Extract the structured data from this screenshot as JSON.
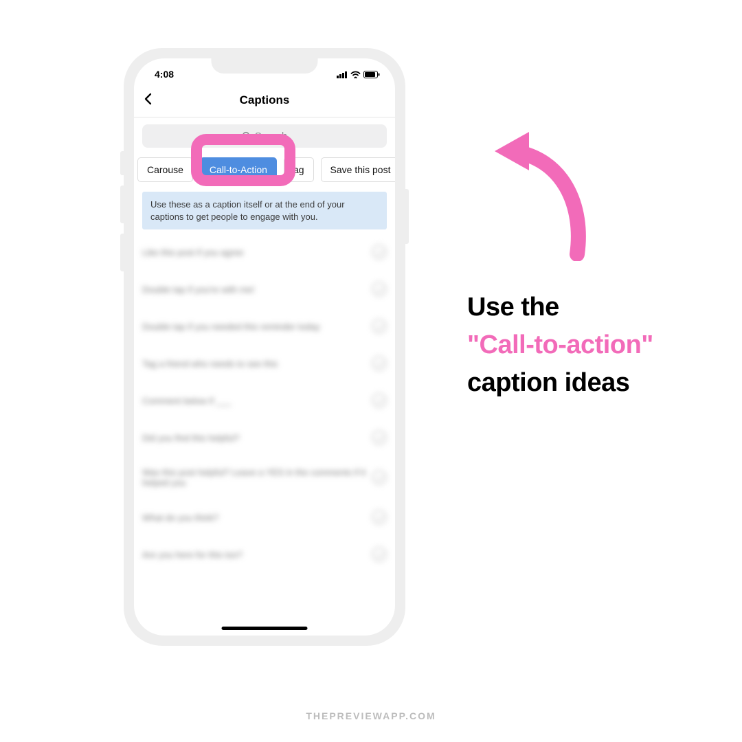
{
  "status": {
    "time": "4:08"
  },
  "header": {
    "title": "Captions"
  },
  "search": {
    "placeholder": "Search"
  },
  "chips": {
    "items": [
      {
        "label": "Carouse"
      },
      {
        "label": "Call-to-Action"
      },
      {
        "label": "ag"
      },
      {
        "label": "Save this post"
      }
    ]
  },
  "info": {
    "text": "Use these as a caption itself or at the end of your captions to get people to engage with you."
  },
  "list": {
    "items": [
      {
        "text": "Like this post if you agree"
      },
      {
        "text": "Double tap if you're with me!"
      },
      {
        "text": "Double tap if you needed this reminder today"
      },
      {
        "text": "Tag a friend who needs to see this"
      },
      {
        "text": "Comment below if ___"
      },
      {
        "text": "Did you find this helpful?"
      },
      {
        "text": "Was this post helpful? Leave a YES in the comments if it helped you"
      },
      {
        "text": "What do you think?"
      },
      {
        "text": "Are you here for this too?"
      }
    ]
  },
  "headline": {
    "line1": "Use the",
    "highlight": "\"Call-to-action\"",
    "line3": "caption ideas"
  },
  "footer": {
    "brand": "THEPREVIEWAPP.COM"
  },
  "colors": {
    "pink": "#f26bb9",
    "blue": "#4e8de0"
  }
}
